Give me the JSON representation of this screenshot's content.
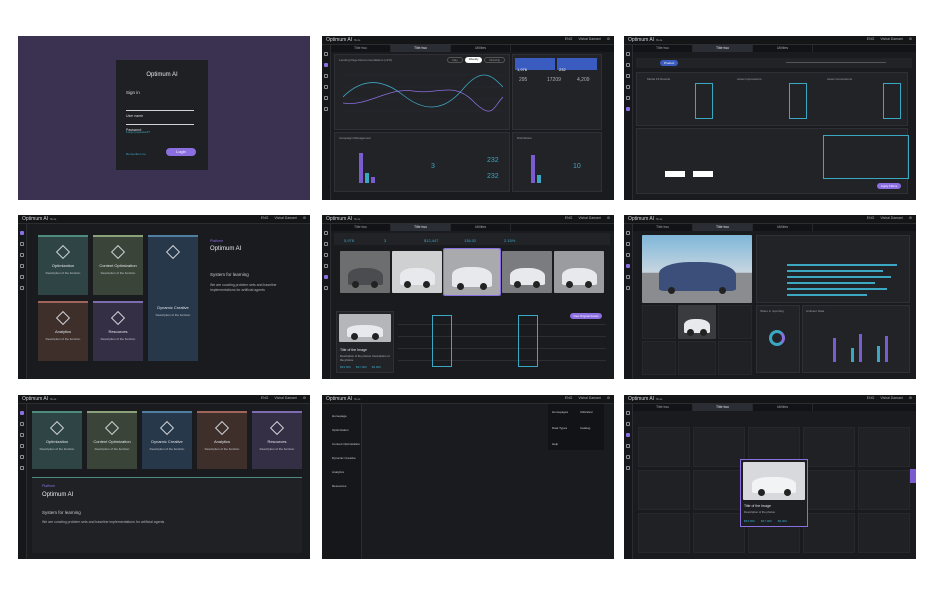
{
  "app": {
    "name": "Optimum AI",
    "version": "Beta",
    "user": "Vishal Damani",
    "lang": "ENG"
  },
  "login": {
    "title": "Optimum AI",
    "heading": "Sign in",
    "username_placeholder": "User name",
    "password_placeholder": "Password",
    "forgot": "Forgot password?",
    "remember": "Remember me",
    "login_button": "Login"
  },
  "tabs": [
    "Title two",
    "Title two",
    "Utilities"
  ],
  "dashboard": {
    "chart_title": "Landing Page Recommendations (ctr%)",
    "toggles": [
      "Day",
      "Weekly",
      "Monthly"
    ],
    "kpis": [
      {
        "value": "1,976",
        "label": "Visitors"
      },
      {
        "value": "232",
        "label": "Users in all Devices"
      }
    ],
    "stats": [
      "295",
      "17209",
      "4,209"
    ],
    "campaign_title": "Campaign Management",
    "dist_title": "Distribution",
    "numbers": [
      "3",
      "232",
      "232",
      "10"
    ]
  },
  "product": {
    "filter": "Product",
    "columns": [
      "Model Fit Results",
      "Asset Impressions",
      "Asset Conversions"
    ],
    "apply": "Apply Filters"
  },
  "tiles": [
    {
      "title": "Optimization",
      "desc": "Description of the function",
      "color": "#2f4545",
      "border": "#4e8a7e"
    },
    {
      "title": "Content Optimization",
      "desc": "Description of the function",
      "color": "#3b4438",
      "border": "#8aa17a"
    },
    {
      "title": "Dynamic Creative",
      "desc": "Description of the function",
      "color": "#27384a",
      "border": "#4f7ea0"
    },
    {
      "title": "Analytics",
      "desc": "Description of the function",
      "color": "#3e2f2a",
      "border": "#a0655a"
    },
    {
      "title": "Resources",
      "desc": "Description of the function",
      "color": "#352f45",
      "border": "#7d6cb0"
    }
  ],
  "platform": {
    "tag": "Platform",
    "name": "Optimum AI",
    "subtitle": "System for learning",
    "description": "We are curating problem sets and baseline implementations for artificial agents"
  },
  "gallery": {
    "kpi_values": [
      "5,978",
      "3",
      "$12,447",
      "136.02",
      "2.15%"
    ],
    "caption_title": "Title of the Image",
    "caption_desc": "Description of the photos. Description of the photos.",
    "cta": "View Original Assets",
    "stats": [
      "$93,500",
      "$37,000",
      "$9,000"
    ]
  },
  "analytics": {
    "chart1": "Share in reporting",
    "chart2": "Ambient Data",
    "legend": [
      "Cat 1",
      "Cat 2",
      "Cat 3"
    ]
  },
  "menu": {
    "items": [
      "Homepage",
      "Optimization",
      "Content Optimization",
      "Dynamic Creative",
      "Analytics",
      "Resources"
    ],
    "dropdown": [
      "Homepages",
      "Utilization",
      "Data Types",
      "Catalog",
      "Help"
    ]
  },
  "image_grid": {
    "title": "Title of the Image",
    "desc": "Description of the photos",
    "stats": [
      "$93,500",
      "$37,000",
      "$9,000"
    ]
  }
}
